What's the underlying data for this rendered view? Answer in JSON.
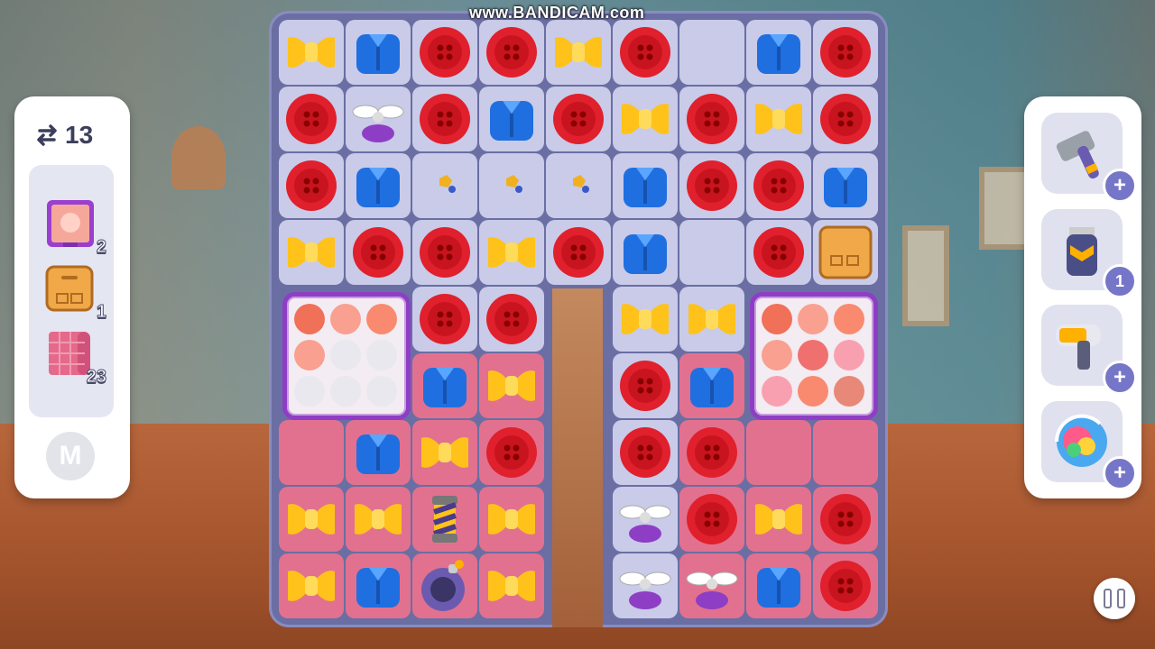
{
  "watermark": "www.BANDICAM.com",
  "moves": {
    "count": "13",
    "icon": "swap-arrows-icon"
  },
  "goals": [
    {
      "name": "painting",
      "count": "2"
    },
    {
      "name": "cardboard-box",
      "count": "1"
    },
    {
      "name": "pink-fabric",
      "count": "23"
    }
  ],
  "m_button": "M",
  "boosters": [
    {
      "name": "hammer",
      "badge": "+"
    },
    {
      "name": "battery",
      "badge": "1"
    },
    {
      "name": "hair-dryer",
      "badge": "+"
    },
    {
      "name": "color-shuffle",
      "badge": "+"
    }
  ],
  "colors": {
    "red": "#e0202c",
    "blue": "#1f6fe0",
    "yellow": "#ffc21a",
    "purple": "#8e3ec4",
    "board": "#6a6ea3"
  },
  "board": {
    "rows": [
      [
        "bow",
        "shirt",
        "button",
        "button",
        "bow",
        "button",
        "empty",
        "shirt",
        "button"
      ],
      [
        "button",
        "propeller",
        "button",
        "shirt",
        "button",
        "bow",
        "button",
        "bow",
        "button"
      ],
      [
        "button",
        "shirt",
        "dust",
        "dust",
        "dust",
        "shirt",
        "button",
        "button",
        "shirt"
      ],
      [
        "bow",
        "button",
        "button",
        "bow",
        "button",
        "shirt",
        "empty",
        "button",
        "box"
      ],
      [
        "big",
        "big",
        "button",
        "button",
        "gap",
        "bow",
        "bow",
        "big",
        "big"
      ],
      [
        "big",
        "big",
        "shirt",
        "bow",
        "gap",
        "button",
        "shirt",
        "big",
        "big"
      ],
      [
        "pink",
        "shirt",
        "bow",
        "button",
        "gap",
        "button",
        "button",
        "pink",
        "pink"
      ],
      [
        "bow",
        "bow",
        "rocket",
        "bow",
        "gap",
        "propeller",
        "button",
        "bow",
        "button"
      ],
      [
        "bow",
        "shirt",
        "bomb",
        "bow",
        "gap",
        "propeller",
        "propeller",
        "shirt",
        "button"
      ]
    ]
  }
}
